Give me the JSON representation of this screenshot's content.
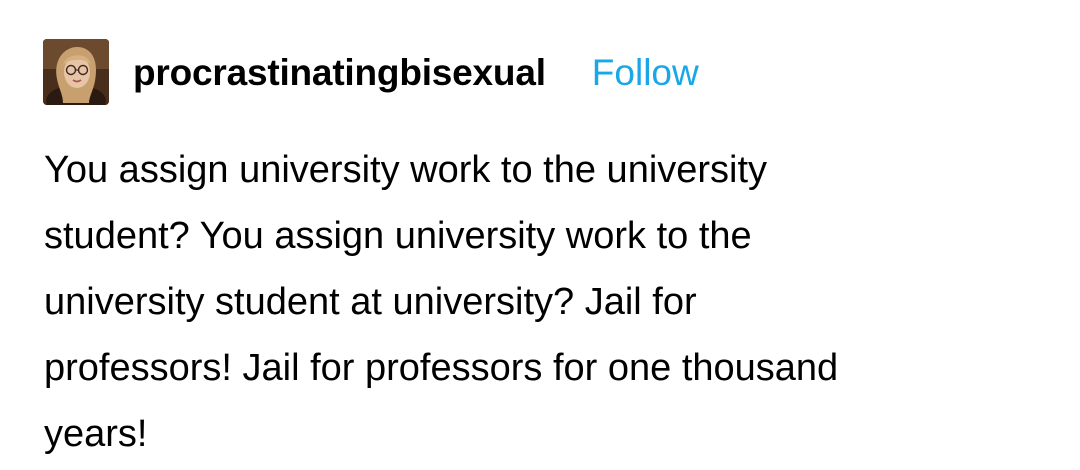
{
  "post": {
    "username": "procrastinatingbisexual",
    "follow_label": "Follow",
    "avatar_icon": "user-avatar-icon",
    "body_lines": [
      "You assign university work to the university",
      "student? You assign university work to the",
      "university student at university? Jail for",
      "professors! Jail for professors for one thousand",
      "years!"
    ]
  },
  "colors": {
    "follow": "#1aa7e6",
    "text": "#000000",
    "background": "#ffffff"
  }
}
